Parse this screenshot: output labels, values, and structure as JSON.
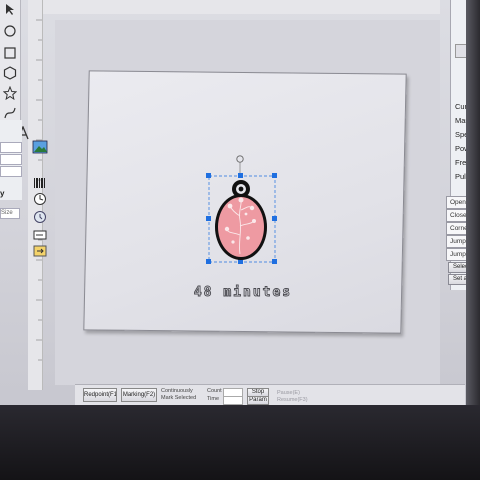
{
  "app": {
    "accent_selection": "#1f6fe0",
    "pendant_fill": "#ee9aa2",
    "pendant_border": "#111111"
  },
  "left_panel": {
    "labels": [
      "y"
    ],
    "field_placeholder": "Size"
  },
  "canvas": {
    "caption": "48 minutes"
  },
  "right_panel": {
    "labels": [
      "Curr",
      "Mark",
      "Spee",
      "Powe",
      "Freque",
      "PulseWi"
    ],
    "delay_fields": [
      "OpenDelay",
      "CloseDelay",
      "Corner Delay",
      "Jump Delay",
      "Jump Speed"
    ],
    "buttons": [
      "Select From",
      "Set as Defa"
    ]
  },
  "bottom_bar": {
    "buttons": [
      "Redpoint(F1)",
      "Marking(F2)",
      "Stop",
      "Param"
    ],
    "options": [
      "Continuously",
      "Mark Selected"
    ],
    "fields": [
      "Count",
      "Time"
    ],
    "greyed": [
      "Pause(E)",
      "Resume(F3)"
    ]
  },
  "icons": [
    "pointer-icon",
    "circle-icon",
    "square-icon",
    "hexagon-icon",
    "star-icon",
    "line-icon",
    "curve-icon",
    "text-icon",
    "image-icon",
    "barcode-icon",
    "clock-icon",
    "time-icon",
    "input-icon",
    "export-icon",
    "rotate-handle-icon"
  ]
}
